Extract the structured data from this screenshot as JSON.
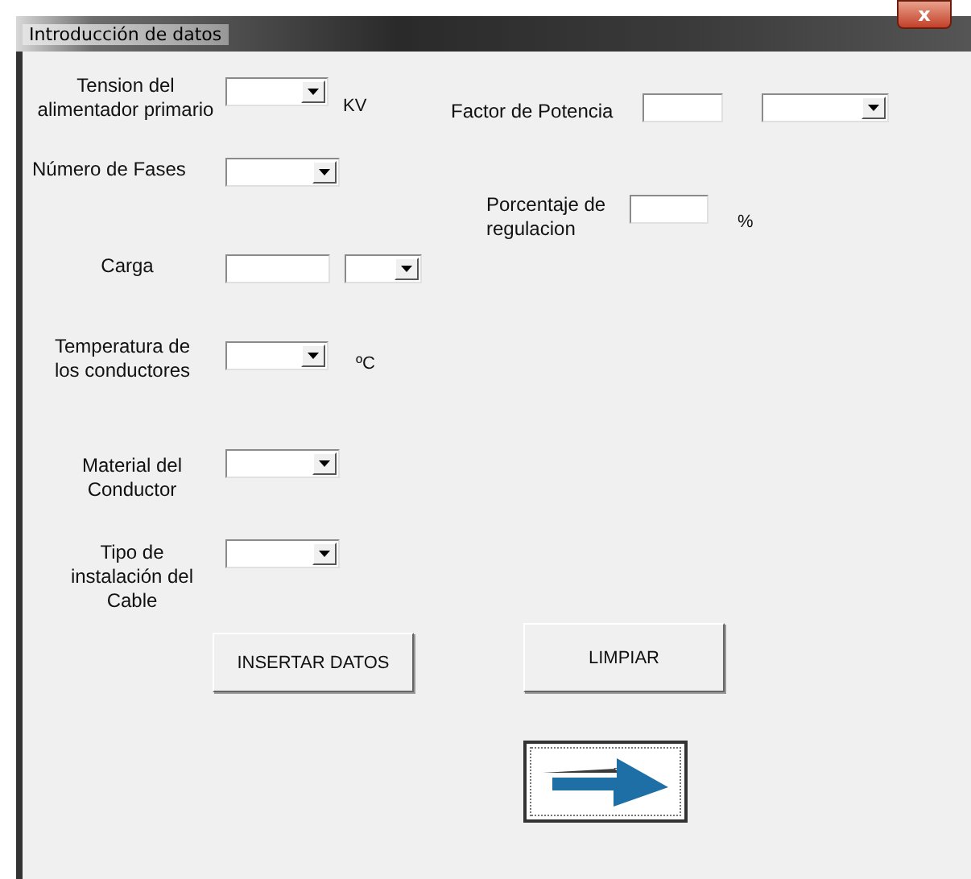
{
  "window": {
    "title": "Introducción de datos",
    "close": "x"
  },
  "fields": [
    {
      "label": "Tension del alimentador primario",
      "controls": [
        {
          "kind": "combo"
        }
      ],
      "unit": "KV"
    },
    {
      "label": "Factor de Potencia",
      "controls": [
        {
          "kind": "text"
        },
        {
          "kind": "combo"
        }
      ]
    },
    {
      "label": "Número de Fases",
      "controls": [
        {
          "kind": "combo"
        }
      ]
    },
    {
      "label": "Porcentaje de regulacion",
      "controls": [
        {
          "kind": "text"
        }
      ],
      "unit": "%"
    },
    {
      "label": "Carga",
      "controls": [
        {
          "kind": "text"
        },
        {
          "kind": "combo"
        }
      ]
    },
    {
      "label": "Temperatura de los conductores",
      "controls": [
        {
          "kind": "combo"
        }
      ],
      "unit": "ºC"
    },
    {
      "label": "Material del Conductor",
      "controls": [
        {
          "kind": "combo"
        }
      ]
    },
    {
      "label": "Tipo de instalación del Cable",
      "controls": [
        {
          "kind": "combo"
        }
      ]
    }
  ],
  "buttons": [
    {
      "kind": "text",
      "label": "INSERTAR DATOS"
    },
    {
      "kind": "text",
      "label": "LIMPIAR"
    },
    {
      "kind": "arrow"
    }
  ]
}
